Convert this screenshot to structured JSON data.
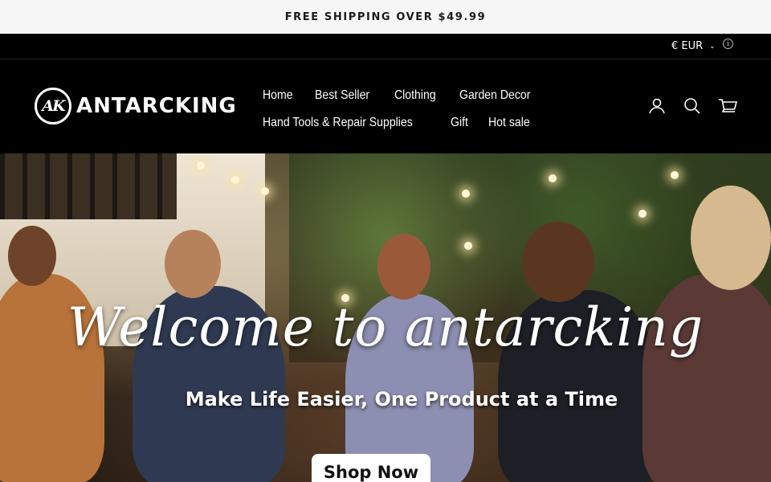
{
  "announcement": {
    "text": "FREE SHIPPING OVER $49.99"
  },
  "utility": {
    "currency": "€ EUR"
  },
  "header": {
    "logo_mark": "AK",
    "logo_text": "ANTARCKING",
    "nav": [
      [
        "Home",
        "Best Seller",
        "Clothing",
        "Garden Decor"
      ],
      [
        "Hand Tools & Repair Supplies",
        "Gift",
        "Hot sale"
      ]
    ],
    "icons": [
      "user-icon",
      "search-icon",
      "cart-icon"
    ]
  },
  "hero": {
    "title": "Welcome to antarcking",
    "subtitle": "Make Life Easier, One Product at a Time",
    "button_label": "Shop Now"
  }
}
